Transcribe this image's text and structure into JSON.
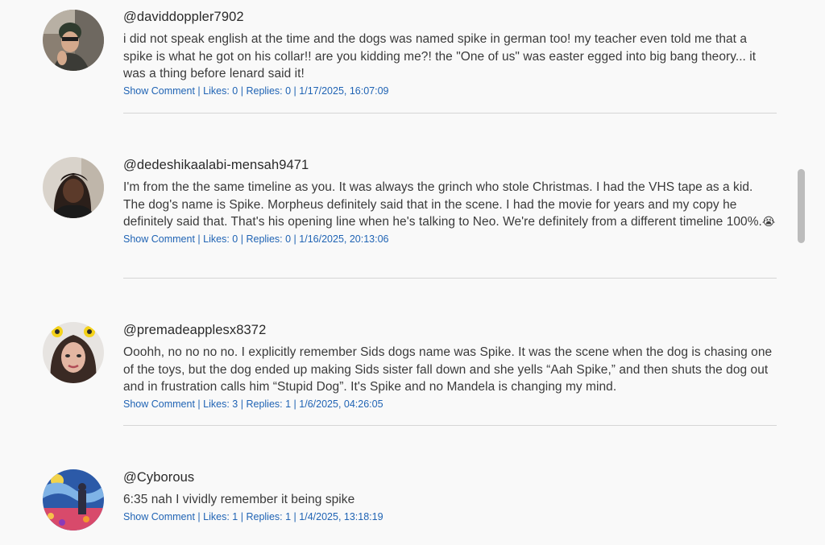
{
  "comments": [
    {
      "author": "@daviddoppler7902",
      "text": "i did not speak english at the time and the dogs was named spike in german too! my teacher even told me that a spike is what he got on his collar!! are you kidding me?! the \"One of us\" was easter egged into big bang theory... it was a thing before lenard said it!",
      "show_comment": "Show Comment",
      "likes": "Likes: 0",
      "replies": "Replies: 0",
      "timestamp": "1/17/2025, 16:07:09"
    },
    {
      "author": "@dedeshikaalabi-mensah9471",
      "text": "I'm from the the same timeline as you. It was always the grinch who stole Christmas. I had the VHS tape as a kid. The dog's name is Spike. Morpheus definitely said that in the scene. I had the movie for years and my copy he definitely said that. That's his opening line when he's talking to Neo. We're definitely from a different timeline 100%.",
      "emoji": "😭",
      "show_comment": "Show Comment",
      "likes": "Likes: 0",
      "replies": "Replies: 0",
      "timestamp": "1/16/2025, 20:13:06"
    },
    {
      "author": "@premadeapplesx8372",
      "text": "Ooohh, no no no no. I explicitly remember Sids dogs name was Spike. It was the scene when the dog is chasing one of the toys, but the dog ended up making Sids sister fall down and she yells “Aah Spike,” and then shuts the dog out and in frustration calls him “Stupid Dog”. It's Spike and no Mandela is changing my mind.",
      "show_comment": "Show Comment",
      "likes": "Likes: 3",
      "replies": "Replies: 1",
      "timestamp": "1/6/2025, 04:26:05"
    },
    {
      "author": "@Cyborous",
      "text": "6:35 nah I vividly remember it being spike",
      "show_comment": "Show Comment",
      "likes": "Likes: 1",
      "replies": "Replies: 1",
      "timestamp": "1/4/2025, 13:18:19"
    }
  ],
  "separator": "|",
  "colors": {
    "background": "#f9f9f9",
    "link": "#1f63b4",
    "author": "#2a2a2a",
    "text": "#3a3a3a",
    "divider": "#d6d6d6",
    "scrollbar_thumb": "#bcbcbc"
  },
  "scrollbar": {
    "visible": true
  }
}
